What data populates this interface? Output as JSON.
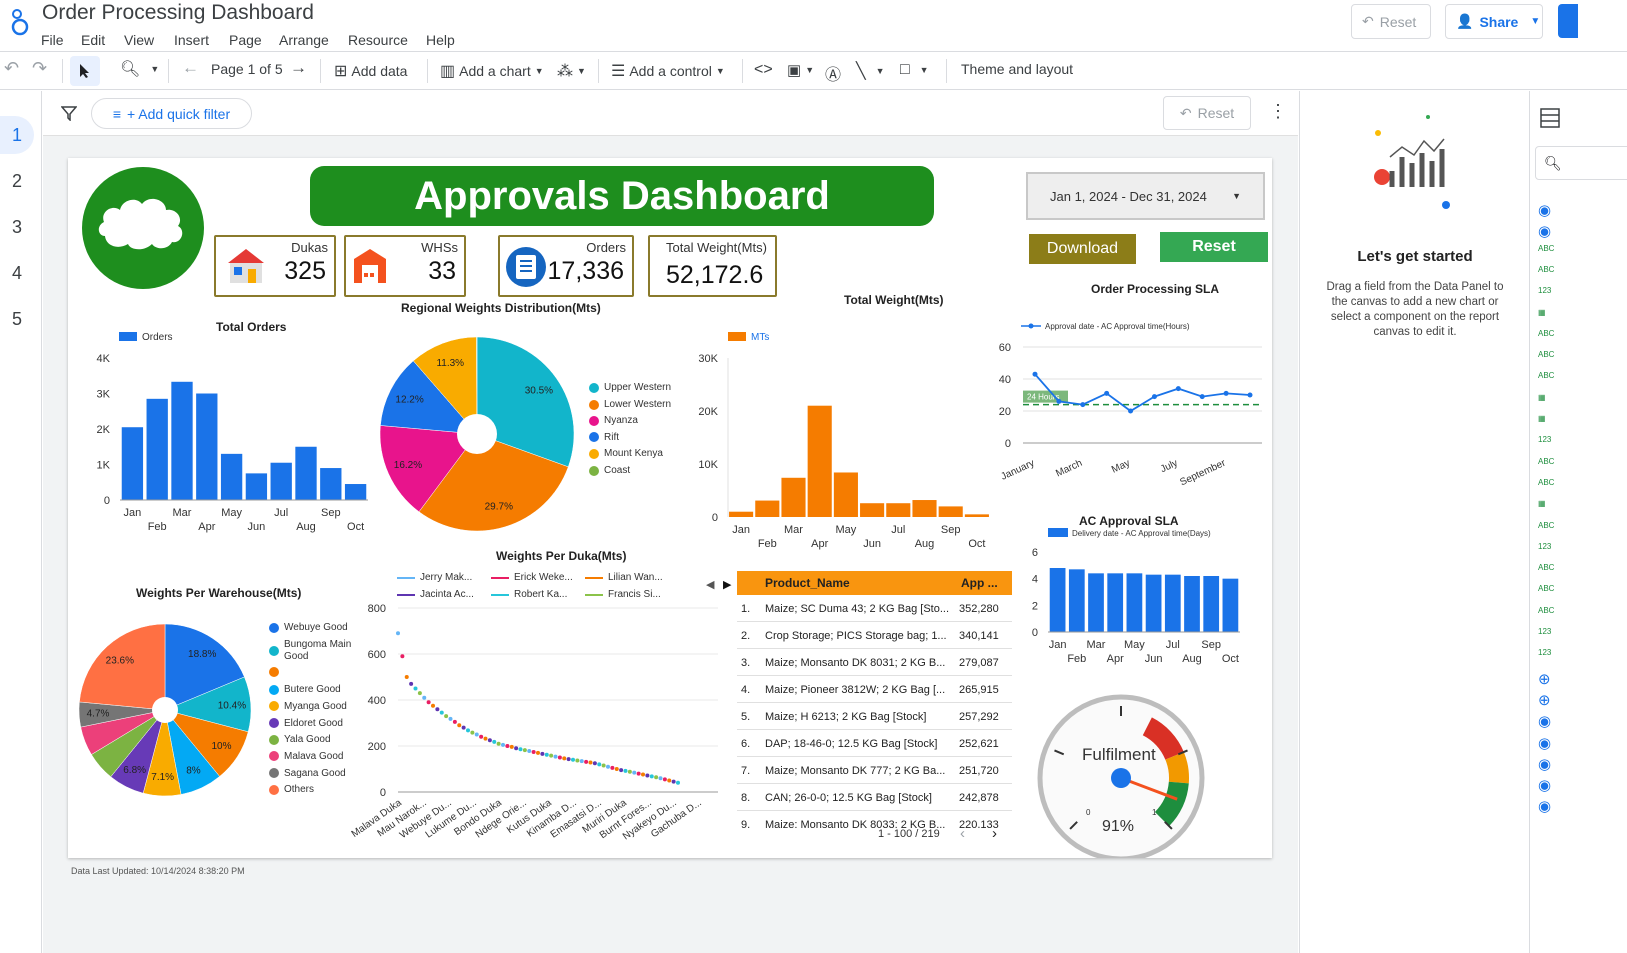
{
  "app": {
    "title": "Order Processing Dashboard",
    "menus": [
      "File",
      "Edit",
      "View",
      "Insert",
      "Page",
      "Arrange",
      "Resource",
      "Help"
    ],
    "reset_label": "Reset",
    "share_label": "Share"
  },
  "toolbar": {
    "page_label": "Page 1 of 5",
    "add_data": "Add data",
    "add_chart": "Add a chart",
    "add_control": "Add a control",
    "theme": "Theme and layout"
  },
  "pages": [
    "1",
    "2",
    "3",
    "4",
    "5"
  ],
  "filterbar": {
    "add_filter": "+ Add quick filter",
    "reset": "Reset"
  },
  "report": {
    "title": "Approvals Dashboard",
    "date_range": "Jan 1, 2024 - Dec 31, 2024",
    "download": "Download",
    "reset": "Reset",
    "footer": "Data Last Updated: 10/14/2024 8:38:20 PM",
    "kpis": [
      {
        "label": "Dukas",
        "value": "325"
      },
      {
        "label": "WHSs",
        "value": "33"
      },
      {
        "label": "Orders",
        "value": "17,336"
      },
      {
        "label": "Total Weight(Mts)",
        "value": "52,172.6"
      }
    ]
  },
  "chart_data": [
    {
      "id": "total_orders",
      "type": "bar",
      "title": "Total Orders",
      "series": [
        {
          "name": "Orders",
          "values": [
            2050,
            2850,
            3330,
            3000,
            1300,
            750,
            1050,
            1500,
            900,
            450
          ]
        }
      ],
      "categories": [
        "Jan",
        "Feb",
        "Mar",
        "Apr",
        "May",
        "Jun",
        "Jul",
        "Aug",
        "Sep",
        "Oct"
      ],
      "yticks": [
        "0",
        "1K",
        "2K",
        "3K",
        "4K"
      ],
      "ylim": [
        0,
        4000
      ],
      "color": "#1a73e8"
    },
    {
      "id": "regional_weights",
      "type": "pie",
      "title": "Regional Weights Distribution(Mts)",
      "labels": [
        "Upper Western",
        "Lower Western",
        "Nyanza",
        "Rift",
        "Mount Kenya",
        "Coast"
      ],
      "values": [
        30.5,
        29.7,
        16.2,
        12.2,
        11.3,
        0.1
      ],
      "colors": [
        "#12b5cb",
        "#f57c00",
        "#e8148c",
        "#1a73e8",
        "#f9ab00",
        "#7cb342"
      ]
    },
    {
      "id": "total_weight",
      "type": "bar",
      "title": "Total Weight(Mts)",
      "series": [
        {
          "name": "MTs",
          "values": [
            1000,
            3100,
            7400,
            21000,
            8400,
            2600,
            2600,
            3200,
            2000,
            500
          ]
        }
      ],
      "categories": [
        "Jan",
        "Feb",
        "Mar",
        "Apr",
        "May",
        "Jun",
        "Jul",
        "Aug",
        "Sep",
        "Oct"
      ],
      "yticks": [
        "0",
        "10K",
        "20K",
        "30K"
      ],
      "ylim": [
        0,
        30000
      ],
      "color": "#f57c00"
    },
    {
      "id": "order_sla",
      "type": "line",
      "title": "Order Processing SLA",
      "series": [
        {
          "name": "Approval date - AC Approval time(Hours)",
          "values": [
            43,
            26,
            24,
            31,
            20,
            29,
            34,
            29,
            31,
            30
          ]
        }
      ],
      "categories": [
        "January",
        "February",
        "March",
        "April",
        "May",
        "June",
        "July",
        "August",
        "September",
        "October"
      ],
      "xticks": [
        "January",
        "March",
        "May",
        "July",
        "September"
      ],
      "yticks": [
        "0",
        "20",
        "40",
        "60"
      ],
      "ylim": [
        0,
        60
      ],
      "reference": {
        "label": "24 Hours",
        "value": 24
      }
    },
    {
      "id": "ac_approval_sla",
      "type": "bar",
      "title": "AC Approval SLA",
      "series": [
        {
          "name": "Delivery date - AC Approval time(Days)",
          "values": [
            4.8,
            4.7,
            4.4,
            4.4,
            4.4,
            4.3,
            4.3,
            4.2,
            4.2,
            4.0
          ]
        }
      ],
      "categories": [
        "Jan",
        "Feb",
        "Mar",
        "Apr",
        "May",
        "Jun",
        "Jul",
        "Aug",
        "Sep",
        "Oct"
      ],
      "yticks": [
        "0",
        "2",
        "4",
        "6"
      ],
      "ylim": [
        0,
        6
      ],
      "color": "#1a73e8"
    },
    {
      "id": "warehouse_weights",
      "type": "pie",
      "title": "Weights Per Warehouse(Mts)",
      "labels": [
        "Webuye Good",
        "Bungoma Main Good",
        "",
        "Butere Good",
        "Myanga Good",
        "Eldoret Good",
        "Yala Good",
        "Malava Good",
        "Sagana Good",
        "Others"
      ],
      "values": [
        18.8,
        10.4,
        10,
        8,
        7.1,
        6.8,
        5.5,
        5.5,
        4.7,
        23.6
      ],
      "slice_labels": [
        "18.8%",
        "10.4%",
        "10%",
        "8%",
        "7.1%",
        "6.8%",
        "",
        "",
        "4.7%",
        "23.6%"
      ],
      "colors": [
        "#1a73e8",
        "#12b5cb",
        "#f57c00",
        "#03a9f4",
        "#f9ab00",
        "#673ab7",
        "#7cb342",
        "#ec407a",
        "#757575",
        "#ff7043"
      ]
    },
    {
      "id": "weights_per_duka",
      "type": "scatter",
      "title": "Weights Per Duka(Mts)",
      "series_names": [
        "Jerry Mak...",
        "Erick Weke...",
        "Lilian Wan...",
        "Jacinta Ac...",
        "Robert Ka...",
        "Francis Si..."
      ],
      "series_colors": [
        "#64b5f6",
        "#e91e63",
        "#f57c00",
        "#5e35b1",
        "#26c6da",
        "#8bc34a"
      ],
      "values": [
        690,
        590,
        500,
        470,
        450,
        430,
        410,
        390,
        375,
        360,
        345,
        330,
        318,
        305,
        290,
        280,
        268,
        258,
        250,
        240,
        232,
        225,
        218,
        210,
        205,
        200,
        196,
        190,
        186,
        182,
        178,
        174,
        170,
        166,
        162,
        158,
        154,
        150,
        146,
        143,
        140,
        137,
        134,
        131,
        128,
        125,
        120,
        115,
        110,
        105,
        100,
        95,
        92,
        88,
        84,
        80,
        76,
        72,
        68,
        64,
        60,
        55,
        50,
        45,
        40
      ],
      "xticks": [
        "Malava Duka",
        "Mau Narok...",
        "Webuye Du...",
        "Lukume Du...",
        "Bondo Duka",
        "Ndege Orie...",
        "Kutus Duka",
        "Kinamba D...",
        "Emasatsi D...",
        "Muriri Duka",
        "Burnt Fores...",
        "Nyakeyo Du...",
        "Gachuba D..."
      ],
      "yticks": [
        "0",
        "200",
        "400",
        "600",
        "800"
      ],
      "ylim": [
        0,
        800
      ]
    },
    {
      "id": "product_table",
      "type": "table",
      "columns": [
        "Product_Name",
        "App ..."
      ],
      "rows": [
        [
          "1.",
          "Maize; SC Duma 43; 2 KG Bag [Sto...",
          "352,280"
        ],
        [
          "2.",
          "Crop Storage; PICS Storage bag; 1...",
          "340,141"
        ],
        [
          "3.",
          "Maize; Monsanto DK 8031; 2 KG B...",
          "279,087"
        ],
        [
          "4.",
          "Maize; Pioneer 3812W; 2 KG Bag [...",
          "265,915"
        ],
        [
          "5.",
          "Maize; H 6213; 2 KG Bag [Stock]",
          "257,292"
        ],
        [
          "6.",
          "DAP; 18-46-0; 12.5 KG Bag [Stock]",
          "252,621"
        ],
        [
          "7.",
          "Maize; Monsanto DK 777; 2 KG Ba...",
          "251,720"
        ],
        [
          "8.",
          "CAN; 26-0-0; 12.5 KG Bag [Stock]",
          "242,878"
        ],
        [
          "9.",
          "Maize; Monsanto DK 8033; 2 KG B...",
          "220,133"
        ]
      ],
      "pagination": "1 - 100 / 219"
    },
    {
      "id": "fulfilment",
      "type": "gauge",
      "title": "Fulfilment",
      "value": 0.91,
      "value_label": "91%",
      "min": "0",
      "max": "1"
    }
  ],
  "right_panel": {
    "title": "Let's get started",
    "text": "Drag a field from the Data Panel to the canvas to add a new chart or select a component on the report canvas to edit it."
  },
  "colors": {
    "accent": "#1a73e8",
    "title_green": "#1e8e1e",
    "download_olive": "#8c7d18",
    "reset_green": "#34a853"
  }
}
